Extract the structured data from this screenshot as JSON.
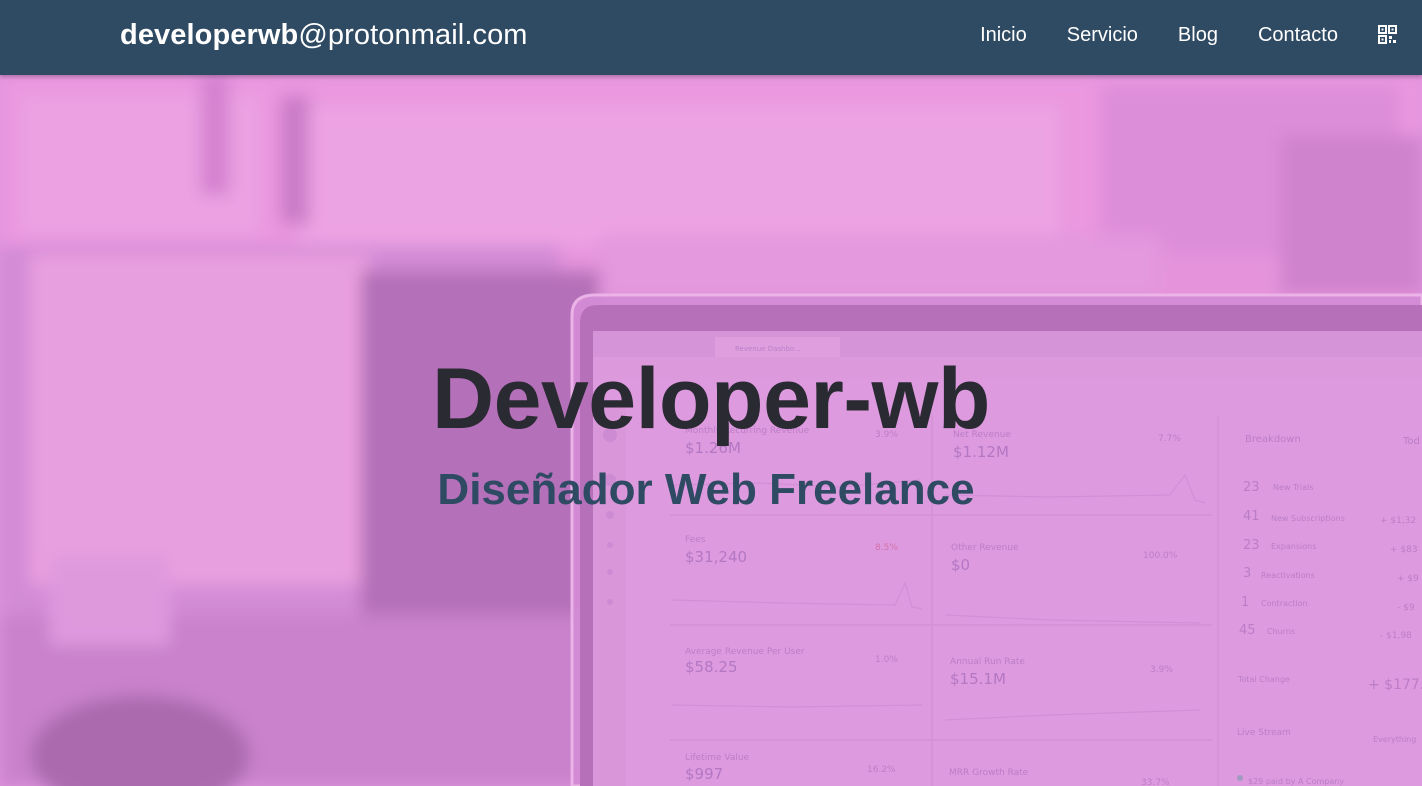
{
  "navbar": {
    "brand_user": "developerwb",
    "brand_domain": "@protonmail.com",
    "links": [
      "Inicio",
      "Servicio",
      "Blog",
      "Contacto"
    ],
    "qr_icon": "qr-code-icon"
  },
  "hero": {
    "title": "Developer-wb",
    "subtitle": "Diseñador Web Freelance",
    "overlay_color": "#e48be0"
  },
  "dashboard": {
    "tab_label": "Revenue Dashbo...",
    "cards": [
      {
        "label": "Monthly Recurring Revenue",
        "value": "$1.26M",
        "change": "3.9%"
      },
      {
        "label": "Net Revenue",
        "value": "$1.12M",
        "change": "7.7%"
      },
      {
        "label": "Fees",
        "value": "$31,240",
        "change": "8.5%"
      },
      {
        "label": "Other Revenue",
        "value": "$0",
        "change": "100.0%"
      },
      {
        "label": "Average Revenue Per User",
        "value": "$58.25",
        "change": "1.0%"
      },
      {
        "label": "Annual Run Rate",
        "value": "$15.1M",
        "change": "3.9%"
      },
      {
        "label": "Lifetime Value",
        "value": "$997",
        "change": "16.2%"
      },
      {
        "label": "MRR Growth Rate",
        "value": "",
        "change": "33.7%"
      }
    ],
    "breakdown_title": "Breakdown",
    "breakdown_right": "Tod",
    "breakdown": [
      {
        "count": "23",
        "label": "New Trials",
        "amount": ""
      },
      {
        "count": "41",
        "label": "New Subscriptions",
        "amount": "+ $1,32"
      },
      {
        "count": "23",
        "label": "Expansions",
        "amount": "+ $83"
      },
      {
        "count": "3",
        "label": "Reactivations",
        "amount": "+ $9"
      },
      {
        "count": "1",
        "label": "Contraction",
        "amount": "- $9"
      },
      {
        "count": "45",
        "label": "Churns",
        "amount": "- $1,98"
      }
    ],
    "total_change_label": "Total Change",
    "total_change_value": "+ $177.",
    "live_stream_label": "Live Stream",
    "live_stream_right": "Everything",
    "live_item": "$29 paid by A Company"
  }
}
